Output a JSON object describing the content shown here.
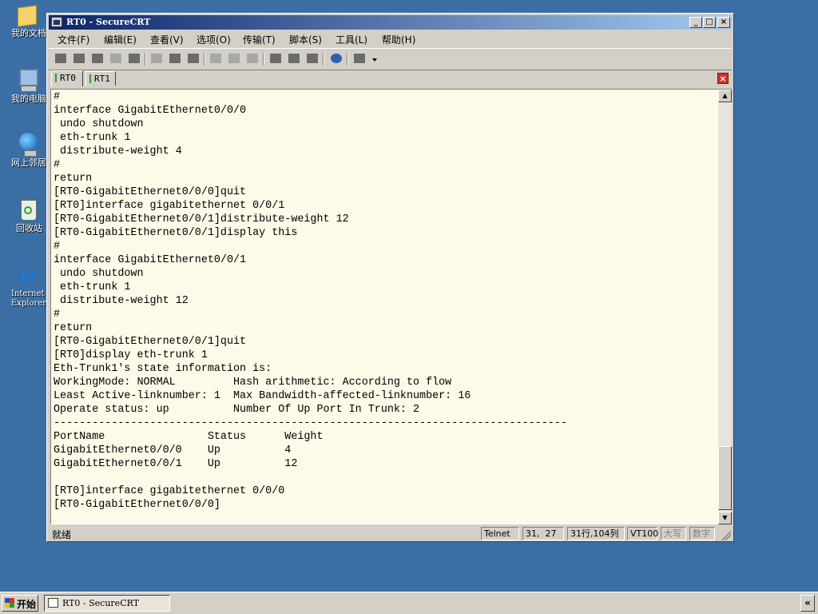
{
  "desktop": {
    "icons": [
      {
        "label": "我的文档",
        "icon": "folder-icon"
      },
      {
        "label": "我的电脑",
        "icon": "computer-icon"
      },
      {
        "label": "网上邻居",
        "icon": "network-icon"
      },
      {
        "label": "回收站",
        "icon": "recycle-bin-icon"
      },
      {
        "label": "Internet Explorer",
        "icon": "ie-icon"
      }
    ]
  },
  "window": {
    "title": "RT0 - SecureCRT",
    "controls": {
      "minimize": "_",
      "maximize": "□",
      "close": "×"
    }
  },
  "menu": [
    "文件(F)",
    "编辑(E)",
    "查看(V)",
    "选项(O)",
    "传输(T)",
    "脚本(S)",
    "工具(L)",
    "帮助(H)"
  ],
  "tabs": [
    {
      "label": "RT0",
      "active": true
    },
    {
      "label": "RT1",
      "active": false
    }
  ],
  "terminal": {
    "lines": [
      "#",
      "interface GigabitEthernet0/0/0",
      " undo shutdown",
      " eth-trunk 1",
      " distribute-weight 4",
      "#",
      "return",
      "[RT0-GigabitEthernet0/0/0]quit",
      "[RT0]interface gigabitethernet 0/0/1",
      "[RT0-GigabitEthernet0/0/1]distribute-weight 12",
      "[RT0-GigabitEthernet0/0/1]display this",
      "#",
      "interface GigabitEthernet0/0/1",
      " undo shutdown",
      " eth-trunk 1",
      " distribute-weight 12",
      "#",
      "return",
      "[RT0-GigabitEthernet0/0/1]quit",
      "[RT0]display eth-trunk 1",
      "Eth-Trunk1's state information is:",
      "WorkingMode: NORMAL         Hash arithmetic: According to flow",
      "Least Active-linknumber: 1  Max Bandwidth-affected-linknumber: 16",
      "Operate status: up          Number Of Up Port In Trunk: 2",
      "--------------------------------------------------------------------------------",
      "PortName                Status      Weight",
      "GigabitEthernet0/0/0    Up          4",
      "GigabitEthernet0/0/1    Up          12",
      "",
      "[RT0]interface gigabitethernet 0/0/0",
      "[RT0-GigabitEthernet0/0/0]"
    ]
  },
  "status": {
    "ready": "就绪",
    "protocol": "Telnet",
    "cursor_pos": "31,  27",
    "rows_cols": "31行,104列",
    "emulation": "VT100",
    "caps": "大写",
    "num": "数字"
  },
  "taskbar": {
    "start": "开始",
    "task": "RT0 - SecureCRT",
    "tray": "«"
  }
}
